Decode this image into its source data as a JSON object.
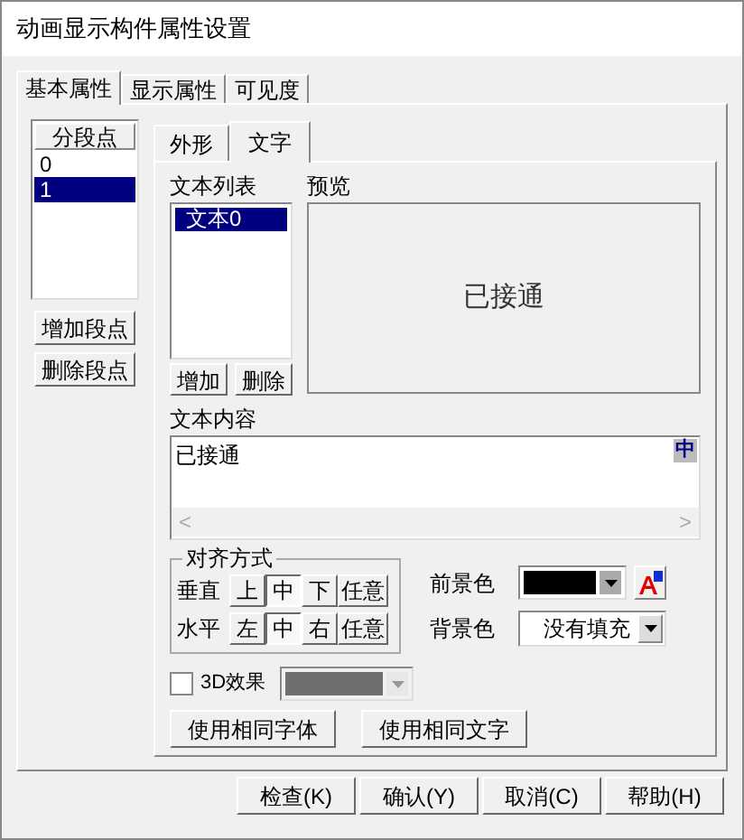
{
  "window": {
    "title": "动画显示构件属性设置"
  },
  "tabs": [
    {
      "label": "基本属性",
      "selected": true
    },
    {
      "label": "显示属性",
      "selected": false
    },
    {
      "label": "可见度",
      "selected": false
    }
  ],
  "segments": {
    "header": "分段点",
    "items": [
      {
        "label": "0",
        "selected": false
      },
      {
        "label": "1",
        "selected": true
      }
    ],
    "buttons": [
      "增加段点",
      "删除段点"
    ]
  },
  "inner_tabs": [
    {
      "label": "外形",
      "selected": false
    },
    {
      "label": "文字",
      "selected": true
    }
  ],
  "text_list": {
    "label": "文本列表",
    "items": [
      {
        "label": "文本0",
        "selected": true
      }
    ],
    "buttons": [
      "增加",
      "删除"
    ]
  },
  "preview": {
    "label": "预览",
    "text": "已接通"
  },
  "text_content": {
    "label": "文本内容",
    "value": "已接通",
    "ime_icon": "中",
    "scroll_left": "<",
    "scroll_right": ">"
  },
  "alignment": {
    "legend": "对齐方式",
    "rows": [
      {
        "label": "垂直",
        "options": [
          {
            "label": "上",
            "selected": false
          },
          {
            "label": "中",
            "selected": true
          },
          {
            "label": "下",
            "selected": false
          },
          {
            "label": "任意",
            "selected": false
          }
        ]
      },
      {
        "label": "水平",
        "options": [
          {
            "label": "左",
            "selected": false
          },
          {
            "label": "中",
            "selected": true
          },
          {
            "label": "右",
            "selected": false
          },
          {
            "label": "任意",
            "selected": false
          }
        ]
      }
    ]
  },
  "foreground": {
    "label": "前景色",
    "color": "#000000"
  },
  "background": {
    "label": "背景色",
    "value": "没有填充"
  },
  "effect_3d": {
    "label": "3D效果",
    "checked": false,
    "disabled": true
  },
  "same_buttons": [
    "使用相同字体",
    "使用相同文字"
  ],
  "footer_buttons": [
    "检查(K)",
    "确认(Y)",
    "取消(C)",
    "帮助(H)"
  ]
}
